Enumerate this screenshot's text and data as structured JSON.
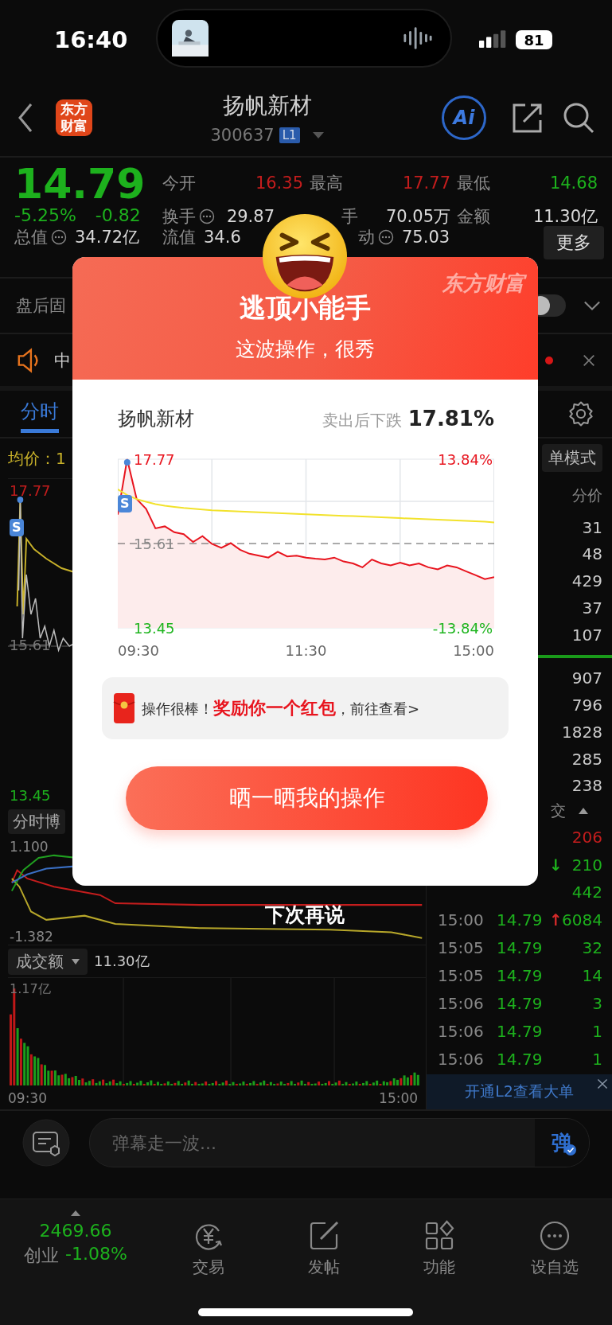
{
  "status_bar": {
    "time": "16:40",
    "battery": "81"
  },
  "header": {
    "logo": "东方财富",
    "title": "扬帆新材",
    "code": "300637",
    "level_badge": "L1",
    "ai_label": "Ai"
  },
  "quote": {
    "price": "14.79",
    "change_pct": "-5.25%",
    "change": "-0.82",
    "color": "#1db11d",
    "stats": [
      {
        "label": "今开",
        "value": "16.35",
        "color": "#c41d1d",
        "info": false
      },
      {
        "label": "最高",
        "value": "17.77",
        "color": "#c41d1d",
        "info": false
      },
      {
        "label": "最低",
        "value": "14.68",
        "color": "#1db11d",
        "info": false
      },
      {
        "label": "换手",
        "value": "29.87",
        "color": "#d8d8d8",
        "info": true
      },
      {
        "label": "手",
        "value": "70.05万",
        "color": "#d8d8d8",
        "info": false
      },
      {
        "label": "金额",
        "value": "11.30亿",
        "color": "#d8d8d8",
        "info": false
      }
    ],
    "row3": [
      {
        "label": "总值",
        "value": "34.72亿",
        "info": true
      },
      {
        "label": "流值",
        "value": "34.6",
        "info": false
      },
      {
        "label": "动",
        "value": "75.03",
        "info": true
      }
    ],
    "more_button": "更多"
  },
  "after_hours": {
    "label": "盘后固",
    "on": false
  },
  "news": {
    "text": "中",
    "unread": true
  },
  "chart_tabs": [
    {
      "label": "分时",
      "selected": true
    }
  ],
  "intraday": {
    "avg_label": "均价：1",
    "price_high": "17.77",
    "price_base": "15.61",
    "price_low": "13.45",
    "sell_marker": "S",
    "game_label": "分时博",
    "game_high": "1.100",
    "game_low": "-1.382",
    "volume_selector": "成交额",
    "volume_total": "11.30亿",
    "volume_max": "1.17亿",
    "time_start": "09:30",
    "time_end": "15:00"
  },
  "order_book": {
    "mode_button": "单模式",
    "column": "分价",
    "asks": [
      "31",
      "48",
      "429",
      "37",
      "107"
    ],
    "bids": [
      "907",
      "796",
      "1828",
      "285",
      "238"
    ]
  },
  "trades": {
    "header": "交",
    "rows": [
      {
        "volume": "206",
        "color": "#c41d1d"
      },
      {
        "arrow": {
          "text": "↓",
          "color": "#1db11d"
        },
        "volume": "210",
        "color": "#1db11d"
      },
      {
        "volume": "442",
        "color": "#1db11d"
      },
      {
        "time": "15:00",
        "price": "14.79",
        "arrow": {
          "text": "↑",
          "color": "#d42a2a"
        },
        "volume": "6084",
        "color": "#1db11d"
      },
      {
        "time": "15:05",
        "price": "14.79",
        "volume": "32",
        "color": "#1db11d"
      },
      {
        "time": "15:05",
        "price": "14.79",
        "volume": "14",
        "color": "#1db11d"
      },
      {
        "time": "15:06",
        "price": "14.79",
        "volume": "3",
        "color": "#1db11d"
      },
      {
        "time": "15:06",
        "price": "14.79",
        "volume": "1",
        "color": "#1db11d"
      },
      {
        "time": "15:06",
        "price": "14.79",
        "volume": "1",
        "color": "#1db11d"
      }
    ]
  },
  "l2_banner": "开通L2查看大单",
  "danmu": {
    "placeholder": "弹幕走一波...",
    "send": "弹"
  },
  "bottom_bar": {
    "index_value": "2469.66",
    "index_name": "创业",
    "index_change": "-1.08%",
    "color": "#1db11d",
    "tabs": [
      {
        "label": "交易",
        "kind": "trade"
      },
      {
        "label": "发帖",
        "kind": "post"
      },
      {
        "label": "功能",
        "kind": "apps"
      },
      {
        "label": "设自选",
        "kind": "more"
      }
    ]
  },
  "popup": {
    "brand": "东方财富",
    "title": "逃顶小能手",
    "subtitle": "这波操作，很秀",
    "stock": "扬帆新材",
    "drop_label": "卖出后下跌",
    "drop_value": "17.81%",
    "sell_marker": "S",
    "pct_high": "13.84%",
    "pct_low": "-13.84%",
    "chart_data": {
      "type": "line",
      "grid": true,
      "ylim": [
        13.45,
        17.77
      ],
      "yticks": [
        {
          "value": 13.45,
          "label": "13.45"
        },
        {
          "value": 15.61,
          "label": "15.61"
        },
        {
          "value": 17.77,
          "label": "17.77"
        }
      ],
      "ref_lines": [
        {
          "axis": "y",
          "value": 15.61
        }
      ],
      "series": [
        {
          "color": "#e8141e",
          "values": [
            16.35,
            17.77,
            16.75,
            16.5,
            16.0,
            16.05,
            15.9,
            15.85,
            15.65,
            15.8,
            15.6,
            15.5,
            15.62,
            15.45,
            15.35,
            15.3,
            15.25,
            15.4,
            15.28,
            15.3,
            15.25,
            15.22,
            15.2,
            15.25,
            15.15,
            15.1,
            15.0,
            15.2,
            15.1,
            15.05,
            15.12,
            15.05,
            15.1,
            15.0,
            14.95,
            15.05,
            15.0,
            14.9,
            14.8,
            14.7,
            14.75
          ]
        },
        {
          "color": "#f2e22c",
          "values": [
            17.0,
            16.85,
            16.75,
            16.68,
            16.62,
            16.58,
            16.55,
            16.52,
            16.5,
            16.48,
            16.46,
            16.45,
            16.44,
            16.43,
            16.42,
            16.41,
            16.4,
            16.39,
            16.38,
            16.37,
            16.36,
            16.35,
            16.34,
            16.33,
            16.32,
            16.31,
            16.3,
            16.29,
            16.28,
            16.27,
            16.26,
            16.25,
            16.24,
            16.23,
            16.22,
            16.21,
            16.2,
            16.19,
            16.18,
            16.17,
            16.15
          ]
        }
      ]
    },
    "time_labels": [
      "09:30",
      "11:30",
      "15:00"
    ],
    "promo": "操作很棒！**奖励你一个红包**，前往查看>",
    "share_button": "晒一晒我的操作",
    "dismiss": "下次再说"
  }
}
